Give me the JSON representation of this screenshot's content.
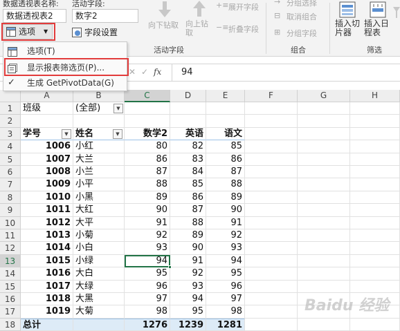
{
  "ribbon": {
    "pivot_name_label": "数据透视表名称:",
    "pivot_name_value": "数据透视表2",
    "options_label": "选项",
    "active_field_label": "活动字段:",
    "active_field_value": "数字2",
    "field_settings_label": "字段设置",
    "drill_down_label": "向下钻取",
    "drill_up_label": "向上钻取",
    "expand_field_label": "展开字段",
    "collapse_field_label": "折叠字段",
    "group_selection_label": "分组选择",
    "ungroup_label": "取消组合",
    "group_field_label": "分组字段",
    "insert_slicer_label": "插入切片器",
    "insert_timeline_label": "插入日程表",
    "group_active_field": "活动字段",
    "group_group": "组合",
    "group_filter": "筛选"
  },
  "dropdown": {
    "items": [
      {
        "label": "选项(T)"
      },
      {
        "label": "显示报表筛选页(P)..."
      },
      {
        "label": "生成 GetPivotData(G)"
      }
    ]
  },
  "formula_bar": {
    "fx_label": "fx",
    "value": "94"
  },
  "sheet": {
    "columns": [
      "A",
      "B",
      "C",
      "D",
      "E",
      "F",
      "G",
      "H"
    ],
    "row_numbers": [
      "1",
      "2",
      "3",
      "4",
      "5",
      "6",
      "7",
      "8",
      "9",
      "10",
      "11",
      "12",
      "13",
      "14",
      "15",
      "16",
      "17",
      "18"
    ],
    "filter_label": "班级",
    "filter_value": "(全部)",
    "headers": [
      "学号",
      "姓名",
      "数学2",
      "英语",
      "语文"
    ],
    "rows": [
      [
        "1006",
        "小红",
        "80",
        "82",
        "85"
      ],
      [
        "1007",
        "大兰",
        "86",
        "83",
        "86"
      ],
      [
        "1008",
        "小兰",
        "87",
        "84",
        "87"
      ],
      [
        "1009",
        "小平",
        "88",
        "85",
        "88"
      ],
      [
        "1010",
        "小黑",
        "89",
        "86",
        "89"
      ],
      [
        "1011",
        "大红",
        "90",
        "87",
        "90"
      ],
      [
        "1012",
        "大平",
        "91",
        "88",
        "91"
      ],
      [
        "1013",
        "小菊",
        "92",
        "89",
        "92"
      ],
      [
        "1014",
        "小白",
        "93",
        "90",
        "93"
      ],
      [
        "1015",
        "小绿",
        "94",
        "91",
        "94"
      ],
      [
        "1016",
        "大白",
        "95",
        "92",
        "95"
      ],
      [
        "1017",
        "大绿",
        "96",
        "93",
        "96"
      ],
      [
        "1018",
        "大黑",
        "97",
        "94",
        "97"
      ],
      [
        "1019",
        "大菊",
        "98",
        "95",
        "98"
      ]
    ],
    "total": [
      "总计",
      "",
      "1276",
      "1239",
      "1281"
    ]
  },
  "watermark": "Baidu 经验",
  "colors": {
    "accent_green": "#217346",
    "highlight_red": "#e23b3b",
    "pivot_blue": "#ddebf7"
  }
}
